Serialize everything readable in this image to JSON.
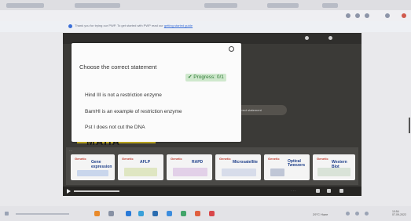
{
  "browser": {
    "tabs": [
      "",
      "",
      "",
      "",
      ""
    ],
    "infobar": {
      "text": "Thank you for trying our PWP. To get started with PWP read our ",
      "link": "getting started guide"
    }
  },
  "quiz": {
    "question": "Choose the correct statement",
    "progress_label": "Progress: 0/1",
    "options": [
      "Hind III is not a restriction enzyme",
      "BamHI is an example of restriction enzyme",
      "Pst I does not cut the DNA"
    ]
  },
  "video": {
    "title_text": "MAHA",
    "background_button": "Correct statement",
    "cards": [
      {
        "title": "Genetic",
        "heading": "Gene expression"
      },
      {
        "title": "Genetic",
        "heading": "AFLP"
      },
      {
        "title": "Genetic",
        "heading": "RAPD"
      },
      {
        "title": "Genetic",
        "heading": "Microsatellite"
      },
      {
        "title": "Genetic",
        "heading": "Optical Tweezers"
      },
      {
        "title": "Genetic",
        "heading": "Western Blot"
      }
    ]
  },
  "taskbar": {
    "tray_text": "29°C Haze",
    "clock": [
      "10:54",
      "07-09-2022"
    ]
  },
  "colors": {
    "accent": "#2f7a36",
    "progress_bg": "#cfe8cd",
    "video_bg": "#3b3a37"
  }
}
